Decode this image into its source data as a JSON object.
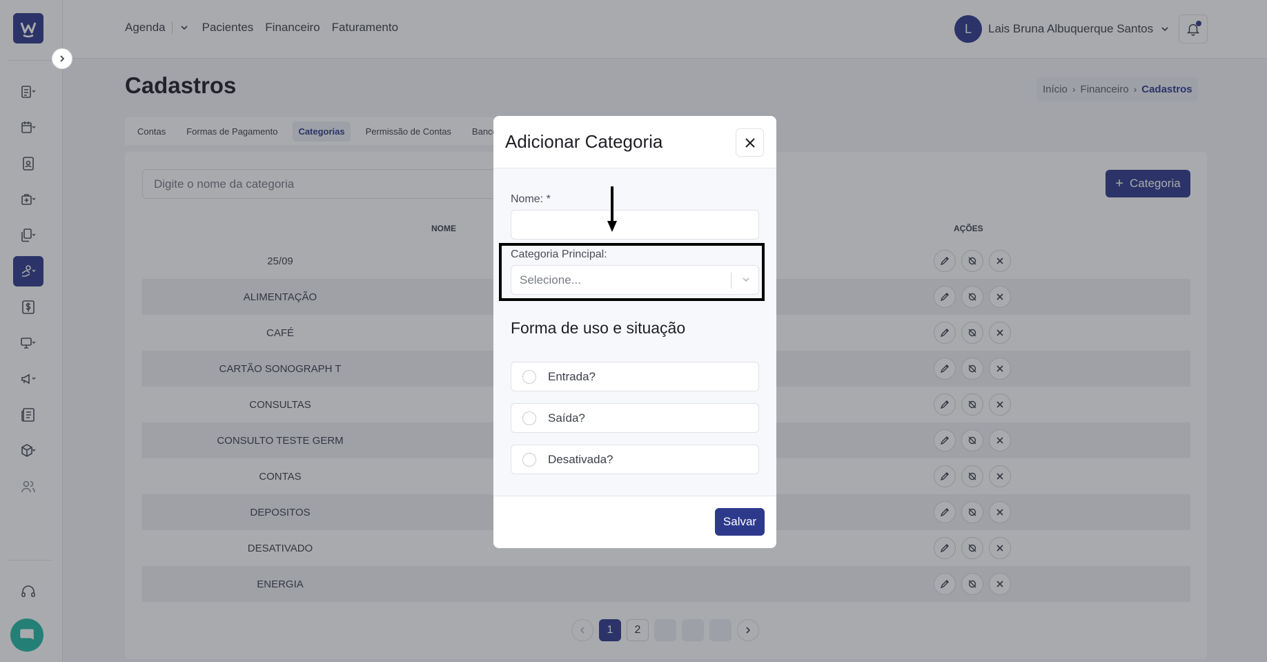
{
  "topnav": {
    "agenda": "Agenda",
    "pacientes": "Pacientes",
    "financeiro": "Financeiro",
    "faturamento": "Faturamento"
  },
  "user": {
    "initial": "L",
    "name": "Lais Bruna Albuquerque Santos"
  },
  "page": {
    "title": "Cadastros",
    "breadcrumb": [
      "Início",
      "Financeiro",
      "Cadastros"
    ]
  },
  "tabs": [
    "Contas",
    "Formas de Pagamento",
    "Categorias",
    "Permissão de Contas",
    "Bancos"
  ],
  "search": {
    "placeholder": "Digite o nome da categoria"
  },
  "add_button_label": "Categoria",
  "table": {
    "headers": {
      "name": "NOME",
      "actions": "AÇÕES"
    },
    "rows": [
      "25/09",
      "ALIMENTAÇÃO",
      "CAFÉ",
      "CARTÃO SONOGRAPH T",
      "CONSULTAS",
      "CONSULTO TESTE GERM",
      "CONTAS",
      "DEPOSITOS",
      "DESATIVADO",
      "ENERGIA"
    ]
  },
  "pagination": {
    "pages": [
      "1",
      "2"
    ],
    "current": "1"
  },
  "modal": {
    "title": "Adicionar Categoria",
    "name_label": "Nome: *",
    "parent_label": "Categoria Principal:",
    "parent_placeholder": "Selecione...",
    "section_title": "Forma de uso e situação",
    "checkboxes": [
      "Entrada?",
      "Saída?",
      "Desativada?"
    ],
    "save_label": "Salvar"
  },
  "colors": {
    "primary": "#2d3a8c",
    "chat": "#22b8a6"
  }
}
